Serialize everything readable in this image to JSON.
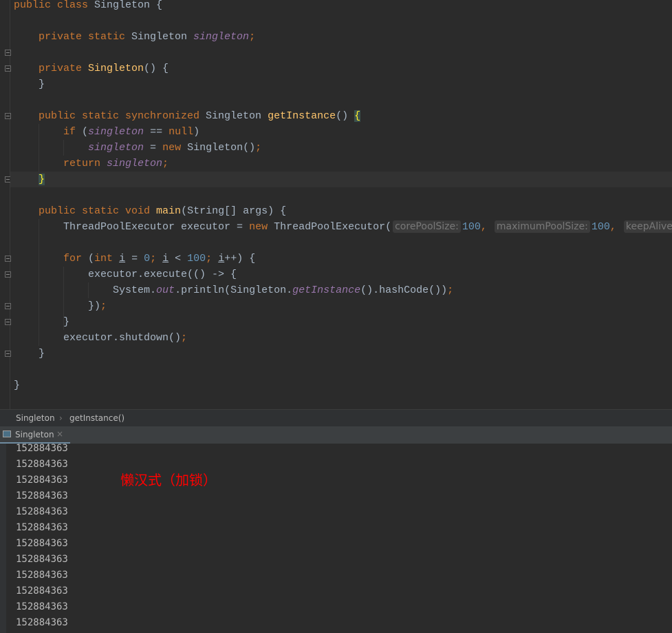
{
  "editor": {
    "current_line": 11,
    "fold_lines": [
      3,
      4,
      7,
      11,
      16,
      17,
      19,
      20,
      22
    ],
    "lines": [
      [
        [
          "public class ",
          "kw"
        ],
        [
          "Singleton {",
          "pl"
        ]
      ],
      [],
      [
        [
          "    private static ",
          "kw"
        ],
        [
          "Singleton ",
          "pl"
        ],
        [
          "singleton",
          "fld"
        ],
        [
          ";",
          "kw"
        ]
      ],
      [],
      [
        [
          "    private ",
          "kw"
        ],
        [
          "Singleton",
          "mth"
        ],
        [
          "() {",
          "pl"
        ]
      ],
      [
        [
          "    }",
          "pl"
        ]
      ],
      [],
      [
        [
          "    public static synchronized ",
          "kw"
        ],
        [
          "Singleton ",
          "pl"
        ],
        [
          "getInstance",
          "mth"
        ],
        [
          "() ",
          "pl"
        ],
        [
          "{",
          "brc"
        ]
      ],
      [
        [
          "        if ",
          "kw"
        ],
        [
          "(",
          "pl"
        ],
        [
          "singleton",
          "fld"
        ],
        [
          " == ",
          "pl"
        ],
        [
          "null",
          "kw"
        ],
        [
          ")",
          "pl"
        ]
      ],
      [
        [
          "            ",
          "pl"
        ],
        [
          "singleton",
          "fld"
        ],
        [
          " = ",
          "pl"
        ],
        [
          "new ",
          "kw"
        ],
        [
          "Singleton()",
          "pl"
        ],
        [
          ";",
          "kw"
        ]
      ],
      [
        [
          "        return ",
          "kw"
        ],
        [
          "singleton",
          "fld"
        ],
        [
          ";",
          "kw"
        ]
      ],
      [
        [
          "    ",
          "pl"
        ],
        [
          "}",
          "brc"
        ]
      ],
      [],
      [
        [
          "    public static void ",
          "kw"
        ],
        [
          "main",
          "mth"
        ],
        [
          "(String[] args) {",
          "pl"
        ]
      ],
      [
        [
          "        ThreadPoolExecutor executor = ",
          "pl"
        ],
        [
          "new ",
          "kw"
        ],
        [
          "ThreadPoolExecutor(",
          "pl"
        ],
        [
          "corePoolSize:",
          "hint"
        ],
        [
          "100",
          "num"
        ],
        [
          ", ",
          "kw"
        ],
        [
          "maximumPoolSize:",
          "hint"
        ],
        [
          "100",
          "num"
        ],
        [
          ", ",
          "kw"
        ],
        [
          "keepAliveTime:",
          "hint"
        ]
      ],
      [],
      [
        [
          "        for ",
          "kw"
        ],
        [
          "(",
          "pl"
        ],
        [
          "int ",
          "kw"
        ],
        [
          "i",
          "ul"
        ],
        [
          " = ",
          "pl"
        ],
        [
          "0",
          "num"
        ],
        [
          "; ",
          "kw"
        ],
        [
          "i",
          "ul"
        ],
        [
          " < ",
          "pl"
        ],
        [
          "100",
          "num"
        ],
        [
          "; ",
          "kw"
        ],
        [
          "i",
          "ul"
        ],
        [
          "++) {",
          "pl"
        ]
      ],
      [
        [
          "            executor.execute(() -> {",
          "pl"
        ]
      ],
      [
        [
          "                System.",
          "pl"
        ],
        [
          "out",
          "fld"
        ],
        [
          ".println(Singleton.",
          "pl"
        ],
        [
          "getInstance",
          "fld"
        ],
        [
          "().hashCode())",
          "pl"
        ],
        [
          ";",
          "kw"
        ]
      ],
      [
        [
          "            })",
          "pl"
        ],
        [
          ";",
          "kw"
        ]
      ],
      [
        [
          "        }",
          "pl"
        ]
      ],
      [
        [
          "        executor.shutdown()",
          "pl"
        ],
        [
          ";",
          "kw"
        ]
      ],
      [
        [
          "    }",
          "pl"
        ]
      ],
      [],
      [
        [
          "}",
          "pl"
        ]
      ]
    ]
  },
  "breadcrumb": {
    "items": [
      "Singleton",
      "getInstance()"
    ],
    "separator": "›"
  },
  "run_panel": {
    "tab_label": "Singleton",
    "close": "×"
  },
  "console": {
    "lines": [
      "152884363",
      "152884363",
      "152884363",
      "152884363",
      "152884363",
      "152884363",
      "152884363",
      "152884363",
      "152884363",
      "152884363",
      "152884363",
      "152884363"
    ],
    "annotation": "懒汉式（加锁）"
  }
}
